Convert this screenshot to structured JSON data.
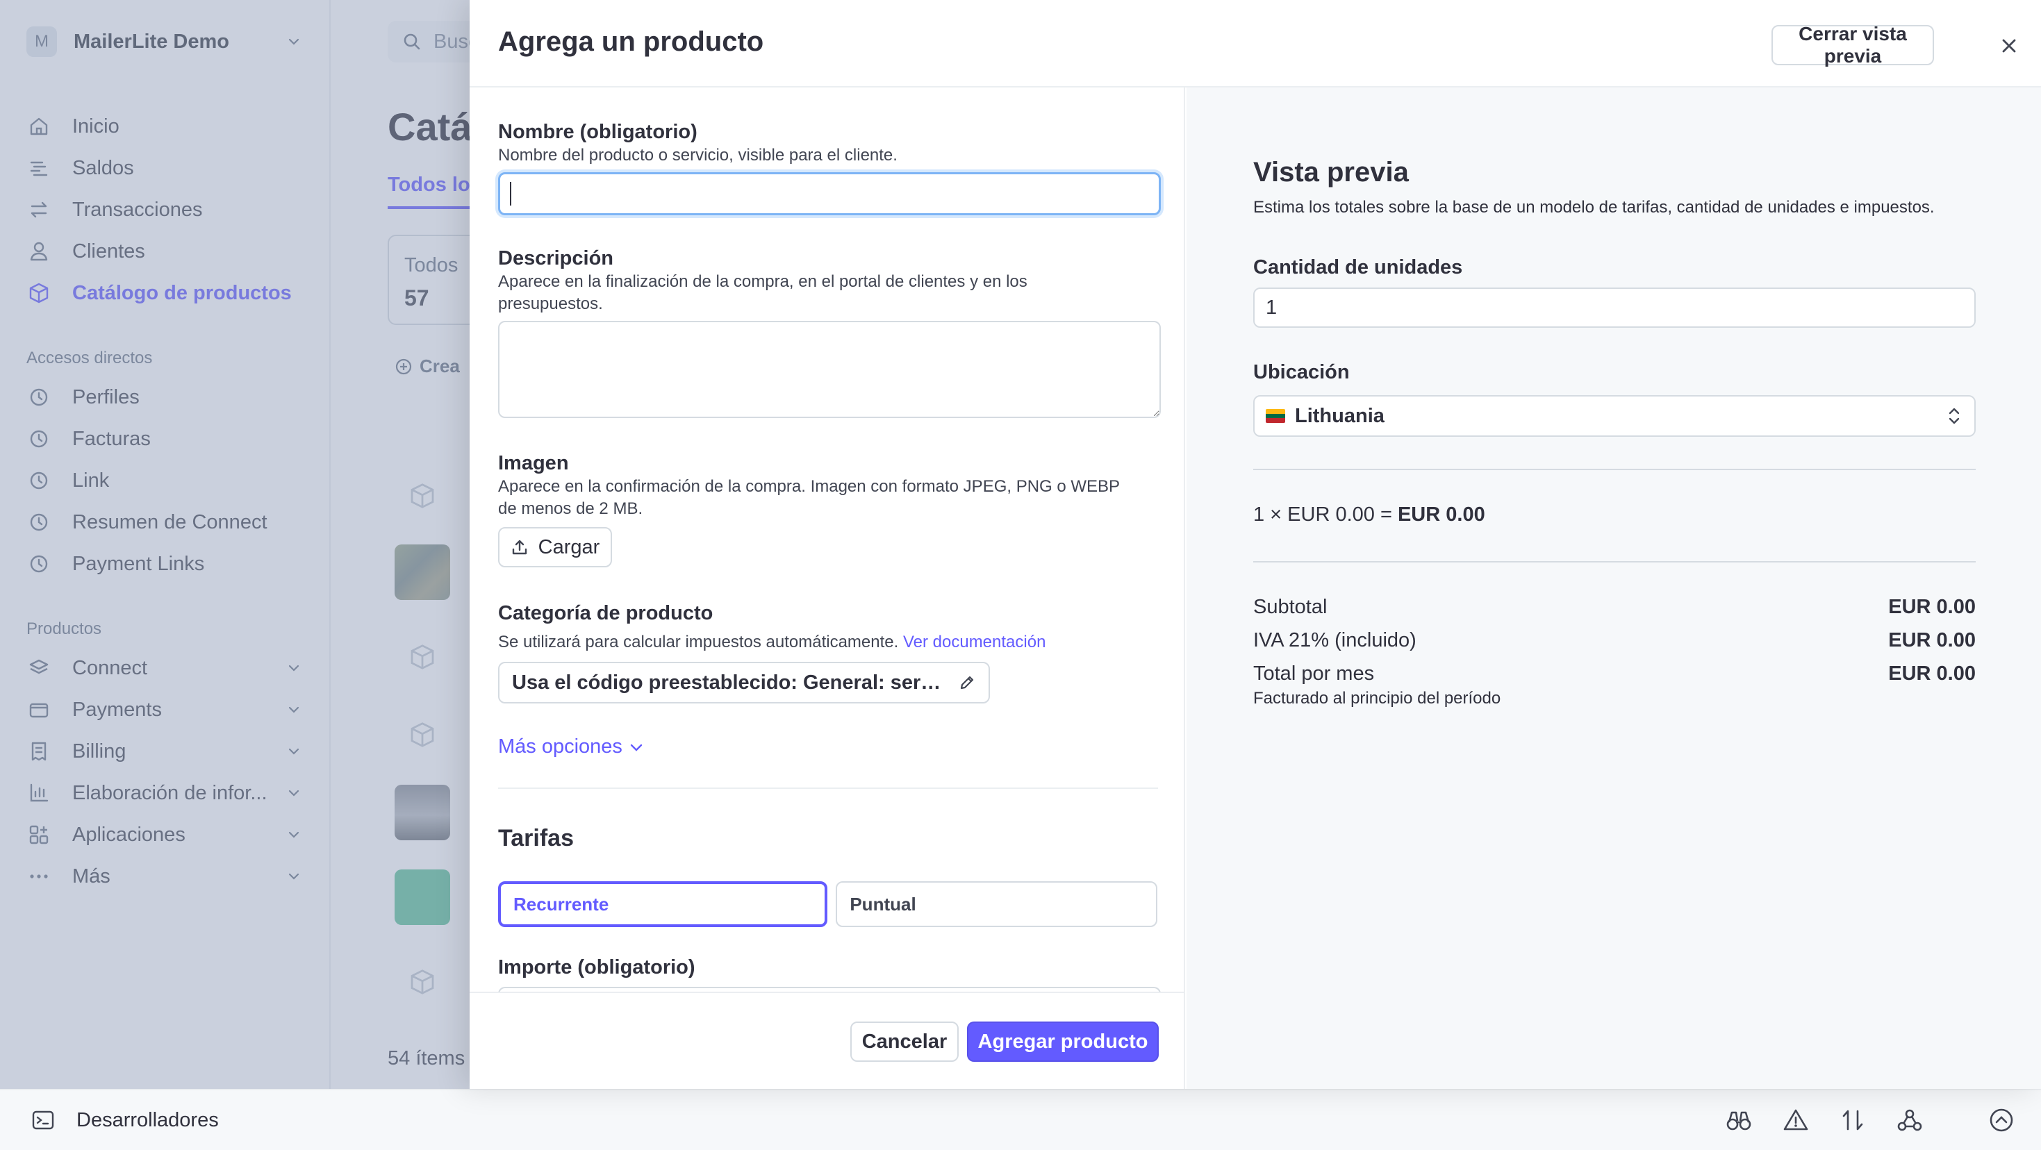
{
  "sidebar": {
    "account_initial": "M",
    "account_name": "MailerLite Demo",
    "nav": [
      {
        "label": "Inicio",
        "icon": "home-icon"
      },
      {
        "label": "Saldos",
        "icon": "balance-icon"
      },
      {
        "label": "Transacciones",
        "icon": "arrows-icon"
      },
      {
        "label": "Clientes",
        "icon": "person-icon"
      },
      {
        "label": "Catálogo de productos",
        "icon": "box-icon",
        "active": true
      }
    ],
    "shortcuts_heading": "Accesos directos",
    "shortcuts": [
      "Perfiles",
      "Facturas",
      "Link",
      "Resumen de Connect",
      "Payment Links"
    ],
    "products_heading": "Productos",
    "products": [
      "Connect",
      "Payments",
      "Billing",
      "Elaboración de infor...",
      "Aplicaciones",
      "Más"
    ]
  },
  "main": {
    "search_placeholder": "Busc",
    "page_title": "Catá",
    "tab_all": "Todos los",
    "filter_label": "Todos",
    "filter_count": "57",
    "create_label": "Crea",
    "items_count": "54 ítems"
  },
  "devbar": {
    "label": "Desarrolladores"
  },
  "drawer": {
    "title": "Agrega un producto",
    "close_preview_label": "Cerrar vista previa",
    "form": {
      "name_label": "Nombre (obligatorio)",
      "name_help": "Nombre del producto o servicio, visible para el cliente.",
      "name_value": "",
      "description_label": "Descripción",
      "description_help_1": "Aparece en la finalización de la compra, en el portal de clientes y en los",
      "description_help_2": "presupuestos.",
      "image_label": "Imagen",
      "image_help_1": "Aparece en la confirmación de la compra. Imagen con formato JPEG, PNG o WEBP",
      "image_help_2": "de menos de 2 MB.",
      "upload_label": "Cargar",
      "category_label": "Categoría de producto",
      "category_help": "Se utilizará para calcular impuestos automáticamente.",
      "category_link": "Ver documentación",
      "category_value": "Usa el código preestablecido: General: servic...",
      "more_options": "Más opciones",
      "pricing_title": "Tarifas",
      "pricing_options": [
        "Recurrente",
        "Puntual"
      ],
      "pricing_selected": "Recurrente",
      "amount_label": "Importe (obligatorio)"
    },
    "footer": {
      "cancel_label": "Cancelar",
      "submit_label": "Agregar producto"
    },
    "preview": {
      "title": "Vista previa",
      "subtitle": "Estima los totales sobre la base de un modelo de tarifas, cantidad de unidades e impuestos.",
      "quantity_label": "Cantidad de unidades",
      "quantity_value": "1",
      "location_label": "Ubicación",
      "location_value": "Lithuania",
      "calc_prefix": "1 × EUR 0.00 = ",
      "calc_result": "EUR 0.00",
      "subtotal_label": "Subtotal",
      "subtotal_value": "EUR 0.00",
      "tax_label": "IVA 21% (incluido)",
      "tax_value": "EUR 0.00",
      "total_label": "Total por mes",
      "total_value": "EUR 0.00",
      "billed_note": "Facturado al principio del período"
    }
  },
  "colors": {
    "accent": "#635bff",
    "overlay": "#909cb8",
    "focus_ring": "#7db4f5"
  }
}
